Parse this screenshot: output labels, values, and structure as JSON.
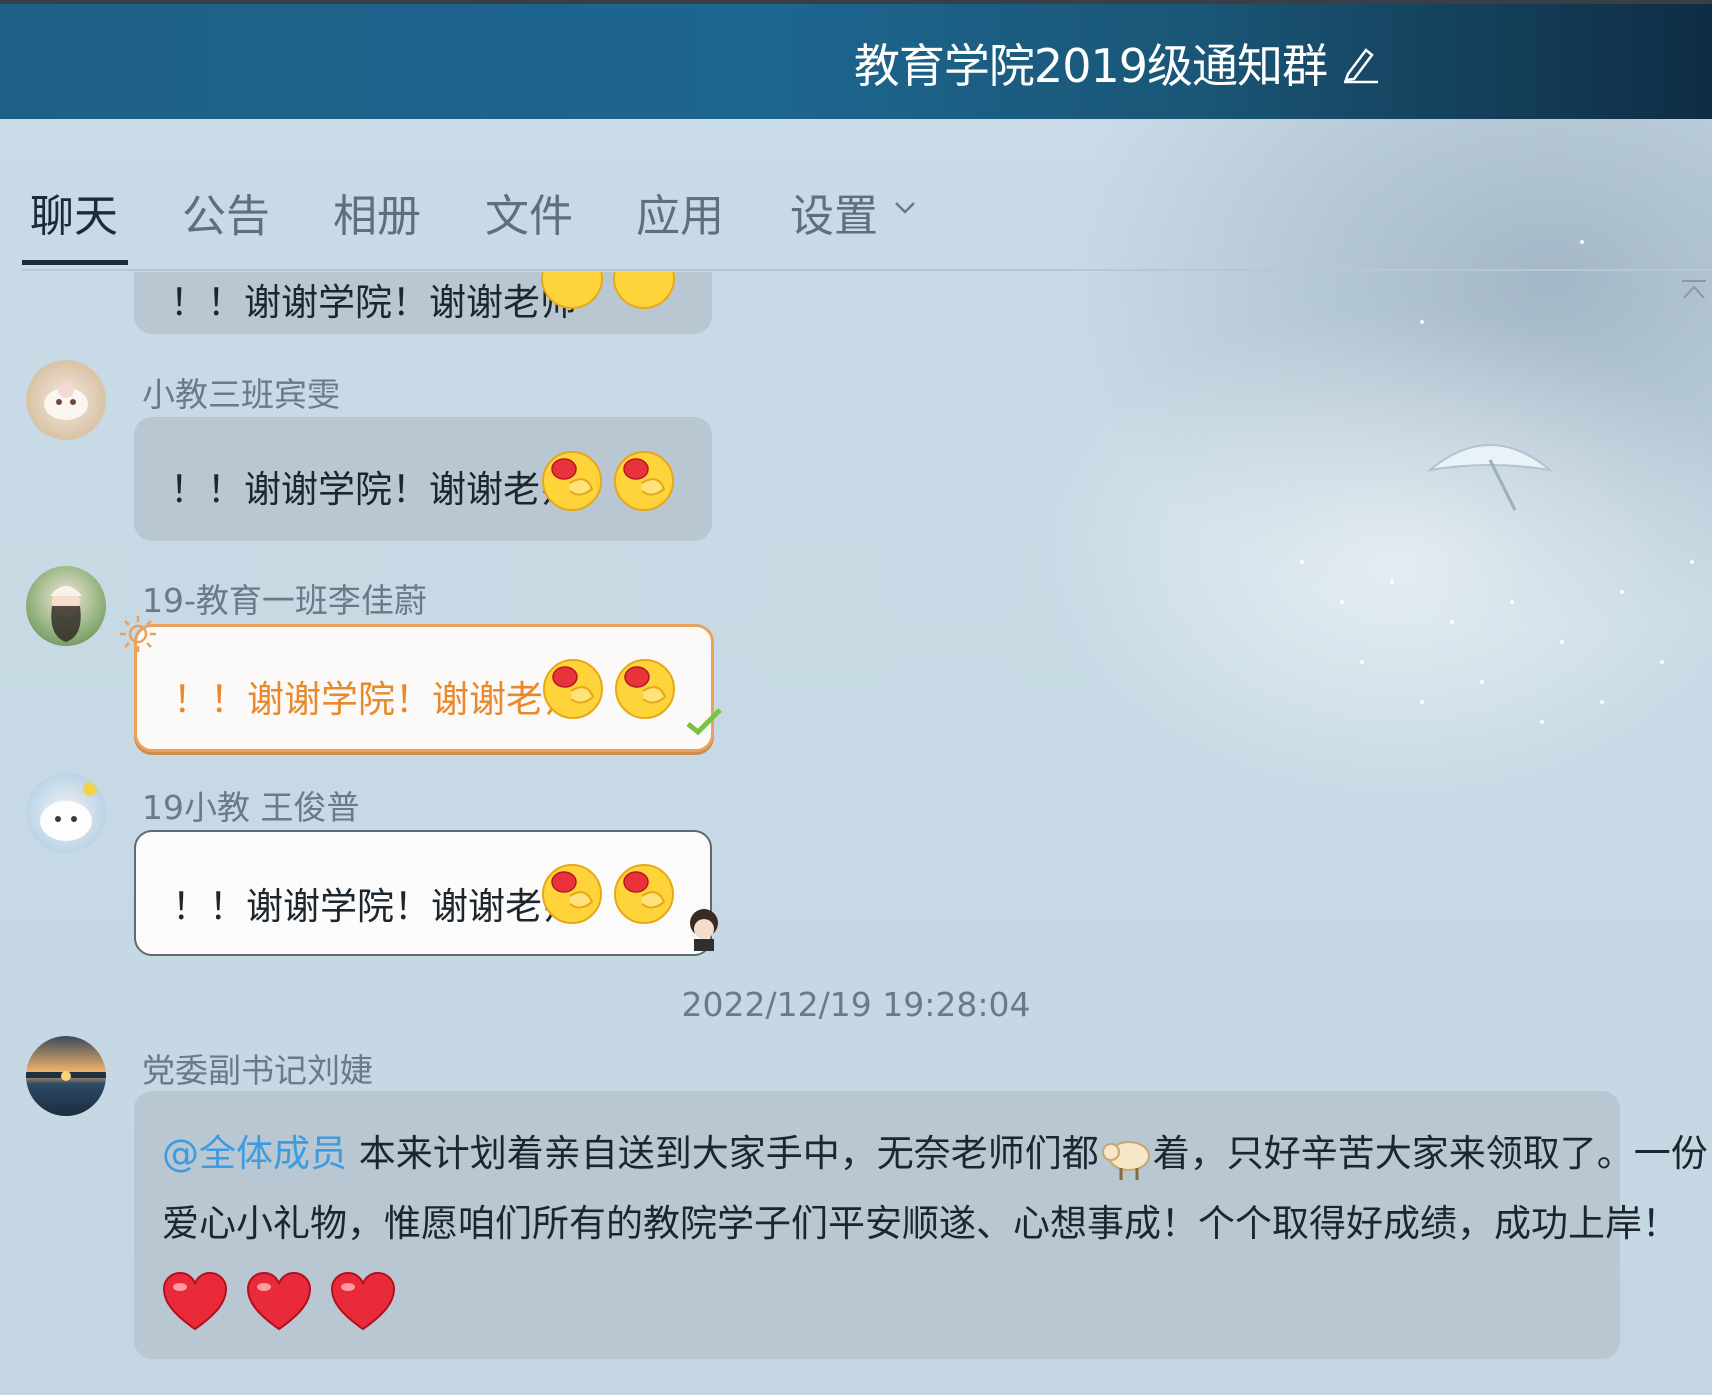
{
  "window": {
    "title": "教育学院2019级通知群"
  },
  "tabs": [
    {
      "label": "聊天",
      "active": true
    },
    {
      "label": "公告",
      "active": false
    },
    {
      "label": "相册",
      "active": false
    },
    {
      "label": "文件",
      "active": false
    },
    {
      "label": "应用",
      "active": false
    },
    {
      "label": "设置",
      "active": false
    }
  ],
  "messages": [
    {
      "sender": "",
      "text": "！！谢谢学院！谢谢老师",
      "emojis": [
        "yawn-emoji",
        "yawn-emoji"
      ],
      "partial": true
    },
    {
      "sender": "小教三班宾雯",
      "text": "！！谢谢学院！谢谢老师",
      "emojis": [
        "yawn-emoji",
        "yawn-emoji"
      ]
    },
    {
      "sender": "19-教育一班李佳蔚",
      "text": "！！谢谢学院！谢谢老师",
      "emojis": [
        "yawn-emoji",
        "yawn-emoji"
      ],
      "text_color": "#e8892b"
    },
    {
      "sender": "19小教 王俊普",
      "text": "！！谢谢学院！谢谢老师",
      "emojis": [
        "yawn-emoji",
        "yawn-emoji"
      ]
    }
  ],
  "timestamp": "2022/12/19 19:28:04",
  "announcement": {
    "sender": "党委副书记刘婕",
    "mention": "@全体成员",
    "line1_a": " 本来计划着亲自送到大家手中，无奈老师们都",
    "line1_b": "着，只好辛苦大家来领取了。一份",
    "line2": "爱心小礼物，惟愿咱们所有的教院学子们平安顺遂、心想事成！个个取得好成绩，成功上岸！",
    "inline_icon": "sheep-icon",
    "hearts": [
      "heart-icon",
      "heart-icon",
      "heart-icon"
    ]
  },
  "colors": {
    "titlebar": "#1d6690",
    "accent_orange": "#e8892b",
    "mention_blue": "#3d9be0"
  }
}
